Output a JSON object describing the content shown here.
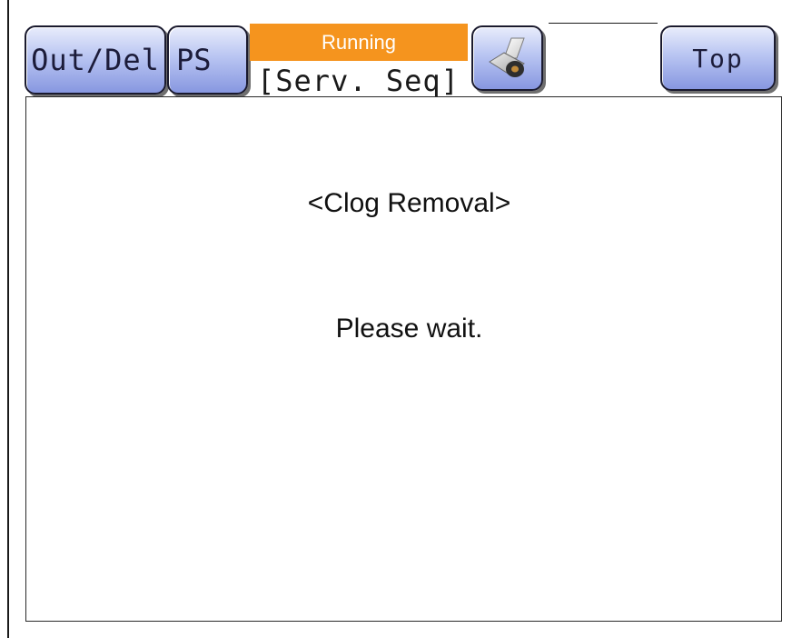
{
  "toolbar": {
    "out_del_label": "Out/Del",
    "ps_label": "PS",
    "top_label": "Top",
    "roll_icon": "paper-roll-icon"
  },
  "status": {
    "text": "Running",
    "color": "#f5941e"
  },
  "screen": {
    "title": "[Serv. Seq]",
    "heading": "<Clog Removal>",
    "message": "Please wait."
  },
  "colors": {
    "button_top": "#e8ecfb",
    "button_bottom": "#8797e0"
  }
}
